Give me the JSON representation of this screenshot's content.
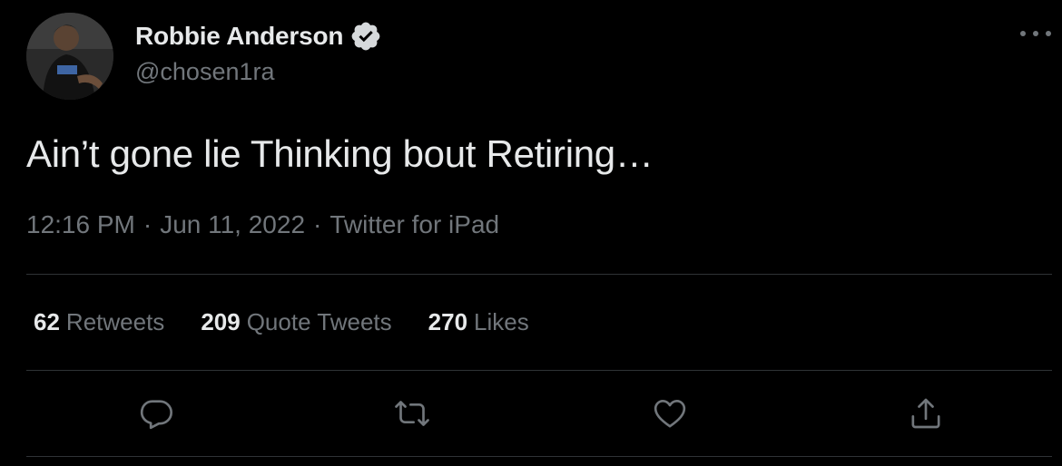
{
  "author": {
    "name": "Robbie Anderson",
    "handle": "@chosen1ra",
    "verified": true
  },
  "tweet": {
    "text": "Ain’t gone lie Thinking bout Retiring…",
    "time": "12:16 PM",
    "separator": "·",
    "date": "Jun 11, 2022",
    "source": "Twitter for iPad"
  },
  "stats": {
    "retweets": {
      "count": "62",
      "label": "Retweets"
    },
    "quotes": {
      "count": "209",
      "label": "Quote Tweets"
    },
    "likes": {
      "count": "270",
      "label": "Likes"
    }
  },
  "actions": [
    "reply-icon",
    "retweet-icon",
    "like-icon",
    "share-icon"
  ],
  "colors": {
    "background": "#000000",
    "primary_text": "#e7e9ea",
    "secondary_text": "#71767b",
    "divider": "#2f3336"
  }
}
